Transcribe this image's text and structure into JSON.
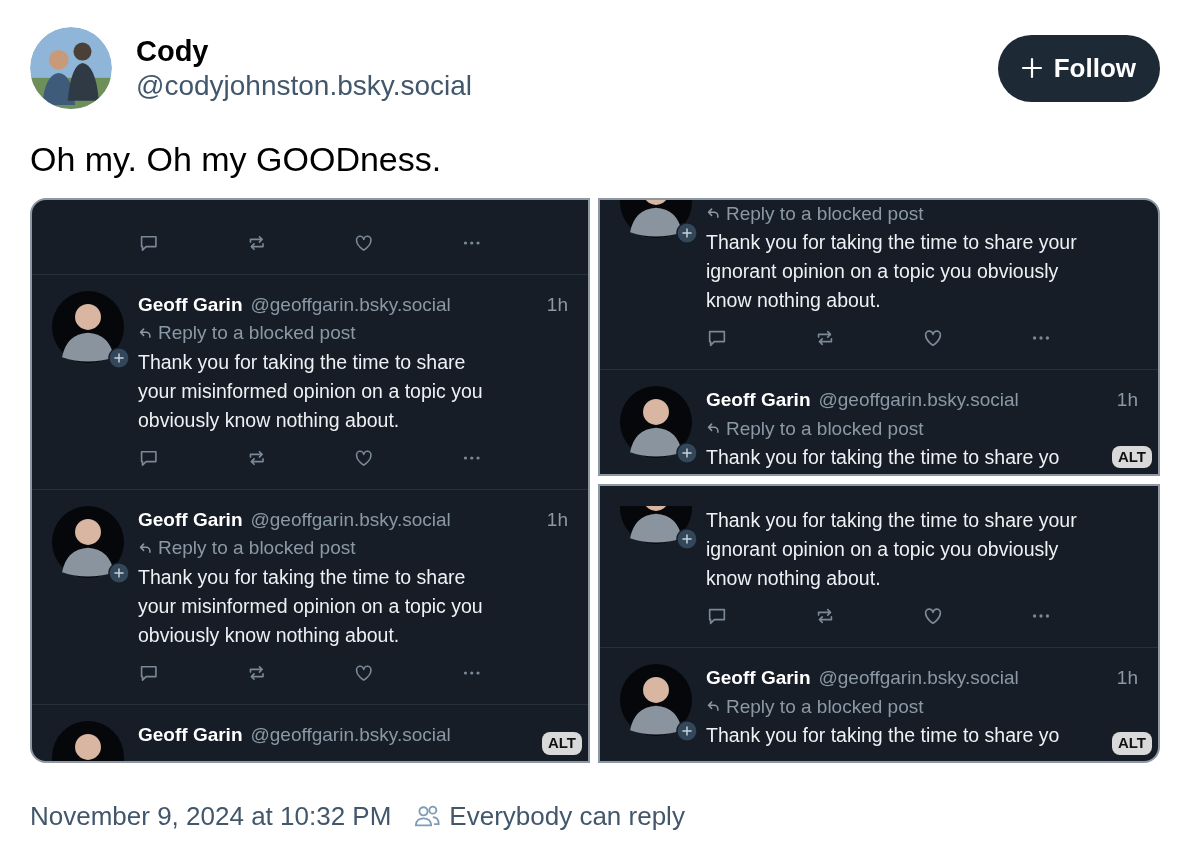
{
  "author": {
    "name": "Cody",
    "handle": "@codyjohnston.bsky.social"
  },
  "follow_button": {
    "label": "Follow"
  },
  "post_text": "Oh my. Oh my GOODness.",
  "images": [
    {
      "alt": "ALT",
      "items": [
        {
          "kind": "actions_only"
        },
        {
          "kind": "post",
          "author": "Geoff Garin",
          "handle": "@geoffgarin.bsky.social",
          "time": "1h",
          "reply_note": "Reply to a blocked post",
          "body_lines": [
            "Thank you for taking the time to share",
            "your misinformed opinion on a topic you",
            "obviously know nothing about."
          ]
        },
        {
          "kind": "post",
          "author": "Geoff Garin",
          "handle": "@geoffgarin.bsky.social",
          "time": "1h",
          "reply_note": "Reply to a blocked post",
          "body_lines": [
            "Thank you for taking the time to share",
            "your misinformed opinion on a topic you",
            "obviously know nothing about."
          ]
        },
        {
          "kind": "cut_post",
          "author": "Geoff Garin",
          "handle": "@geoffgarin.bsky.social"
        }
      ]
    },
    {
      "alt": "ALT",
      "items": [
        {
          "kind": "tail",
          "reply_note": "Reply to a blocked post",
          "body_lines": [
            "Thank you for taking the time to share your",
            "ignorant opinion on a topic you obviously",
            "know nothing about."
          ]
        },
        {
          "kind": "cut_post",
          "author": "Geoff Garin",
          "handle": "@geoffgarin.bsky.social",
          "time": "1h",
          "reply_note": "Reply to a blocked post",
          "body_lines": [
            "Thank you for taking the time to share yo"
          ]
        }
      ]
    },
    {
      "alt": "ALT",
      "items": [
        {
          "kind": "tail",
          "body_lines": [
            "Thank you for taking the time to share your",
            "ignorant opinion on a topic you obviously",
            "know nothing about."
          ]
        },
        {
          "kind": "cut_post",
          "author": "Geoff Garin",
          "handle": "@geoffgarin.bsky.social",
          "time": "1h",
          "reply_note": "Reply to a blocked post",
          "body_lines": [
            "Thank you for taking the time to share yo"
          ]
        }
      ]
    }
  ],
  "footer": {
    "timestamp": "November 9, 2024 at 10:32 PM",
    "reply_setting": "Everybody can reply"
  }
}
